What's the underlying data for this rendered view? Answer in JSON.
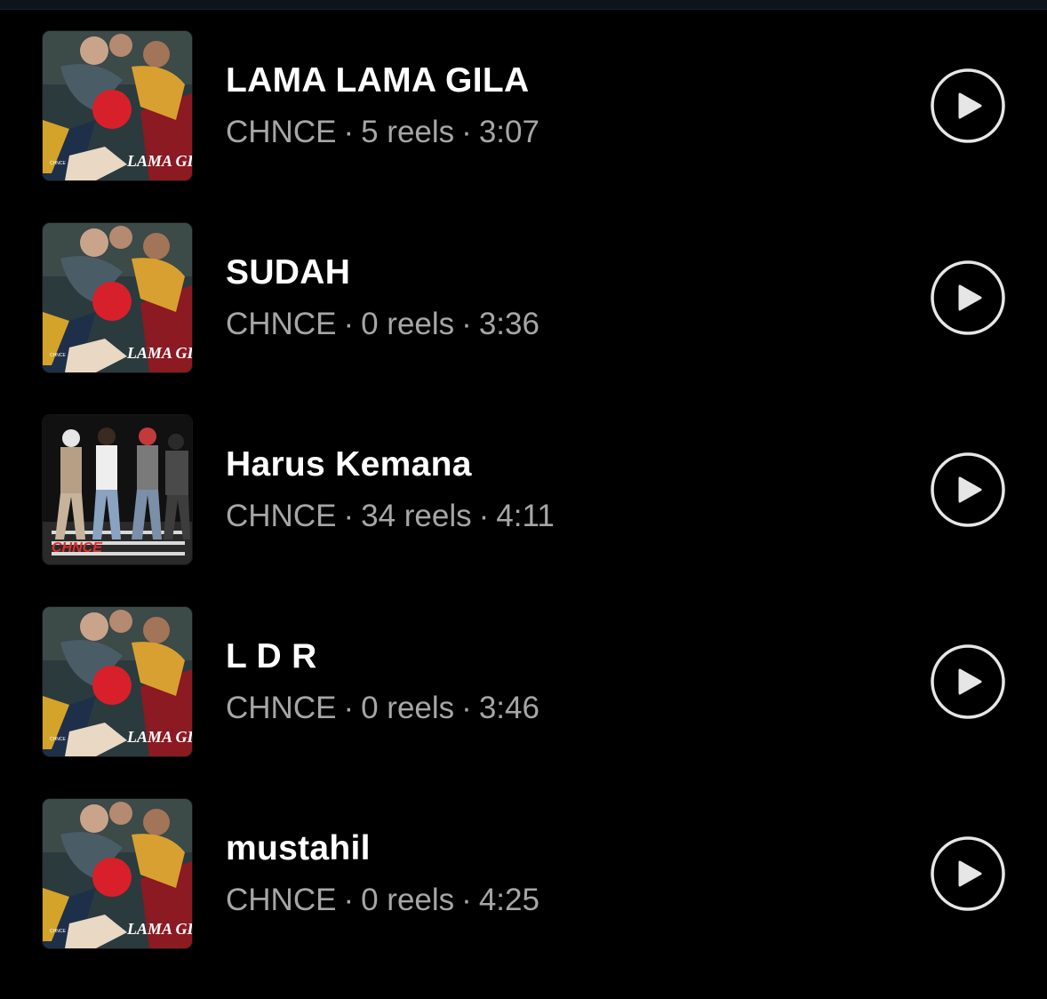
{
  "tracks": [
    {
      "title": "LAMA LAMA GILA",
      "artist": "CHNCE",
      "reels": "5 reels",
      "duration": "3:07",
      "cover": "lama-lama-gila-cover",
      "cover_text": "LAMA GILA",
      "cover_small": "CHNCE"
    },
    {
      "title": "SUDAH",
      "artist": "CHNCE",
      "reels": "0 reels",
      "duration": "3:36",
      "cover": "lama-lama-gila-cover",
      "cover_text": "LAMA GILA",
      "cover_small": "CHNCE"
    },
    {
      "title": "Harus Kemana",
      "artist": "CHNCE",
      "reels": "34 reels",
      "duration": "4:11",
      "cover": "chnce-street-cover",
      "cover_text": "CHNCE",
      "cover_small": ""
    },
    {
      "title": "L D R",
      "artist": "CHNCE",
      "reels": "0 reels",
      "duration": "3:46",
      "cover": "lama-lama-gila-cover",
      "cover_text": "LAMA GILA",
      "cover_small": "CHNCE"
    },
    {
      "title": "mustahil",
      "artist": "CHNCE",
      "reels": "0 reels",
      "duration": "4:25",
      "cover": "lama-lama-gila-cover",
      "cover_text": "LAMA GILA",
      "cover_small": "CHNCE"
    }
  ],
  "separator": "·",
  "icons": {
    "play": "play-circle-icon"
  },
  "colors": {
    "background": "#000000",
    "title": "#ffffff",
    "meta": "#a6a6a6",
    "play_ring": "#e6e6e6"
  }
}
